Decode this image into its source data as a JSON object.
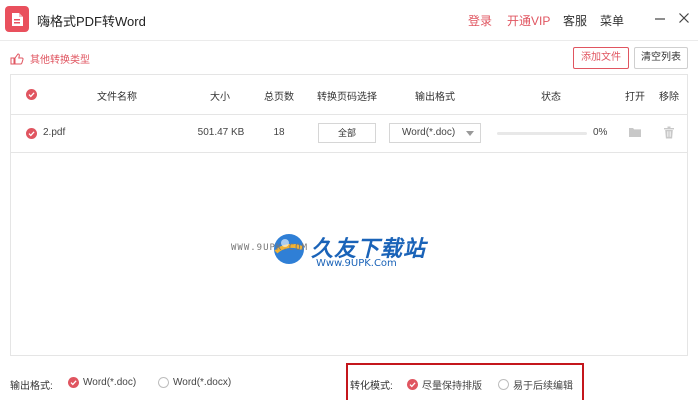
{
  "app": {
    "title": "嗨格式PDF转Word"
  },
  "topbar": {
    "login": "登录",
    "vip": "开通VIP",
    "service": "客服",
    "menu": "菜单"
  },
  "toolbar": {
    "other_types": "其他转换类型",
    "add_file": "添加文件",
    "clear_list": "清空列表"
  },
  "table": {
    "headers": [
      "文件名称",
      "大小",
      "总页数",
      "转换页码选择",
      "输出格式",
      "状态",
      "打开",
      "移除"
    ],
    "rows": [
      {
        "name": "2.pdf",
        "size": "501.47 KB",
        "pages": "18",
        "range": "全部",
        "format": "Word(*.doc)",
        "progress": 0,
        "status": "0%"
      }
    ]
  },
  "watermark": {
    "small": "WWW.9UPK.COM",
    "big": "久友下载站",
    "url": "Www.9UPK.Com"
  },
  "bottom": {
    "output_format_label": "输出格式:",
    "output_formats": [
      {
        "label": "Word(*.doc)",
        "selected": true
      },
      {
        "label": "Word(*.docx)",
        "selected": false
      }
    ],
    "mode_label": "转化模式:",
    "modes": [
      {
        "label": "尽量保持排版",
        "selected": true
      },
      {
        "label": "易于后续编辑",
        "selected": false
      }
    ]
  },
  "colors": {
    "accent": "#e05560",
    "highlight_box": "#c4161c",
    "watermark_blue": "#1a63b8"
  }
}
